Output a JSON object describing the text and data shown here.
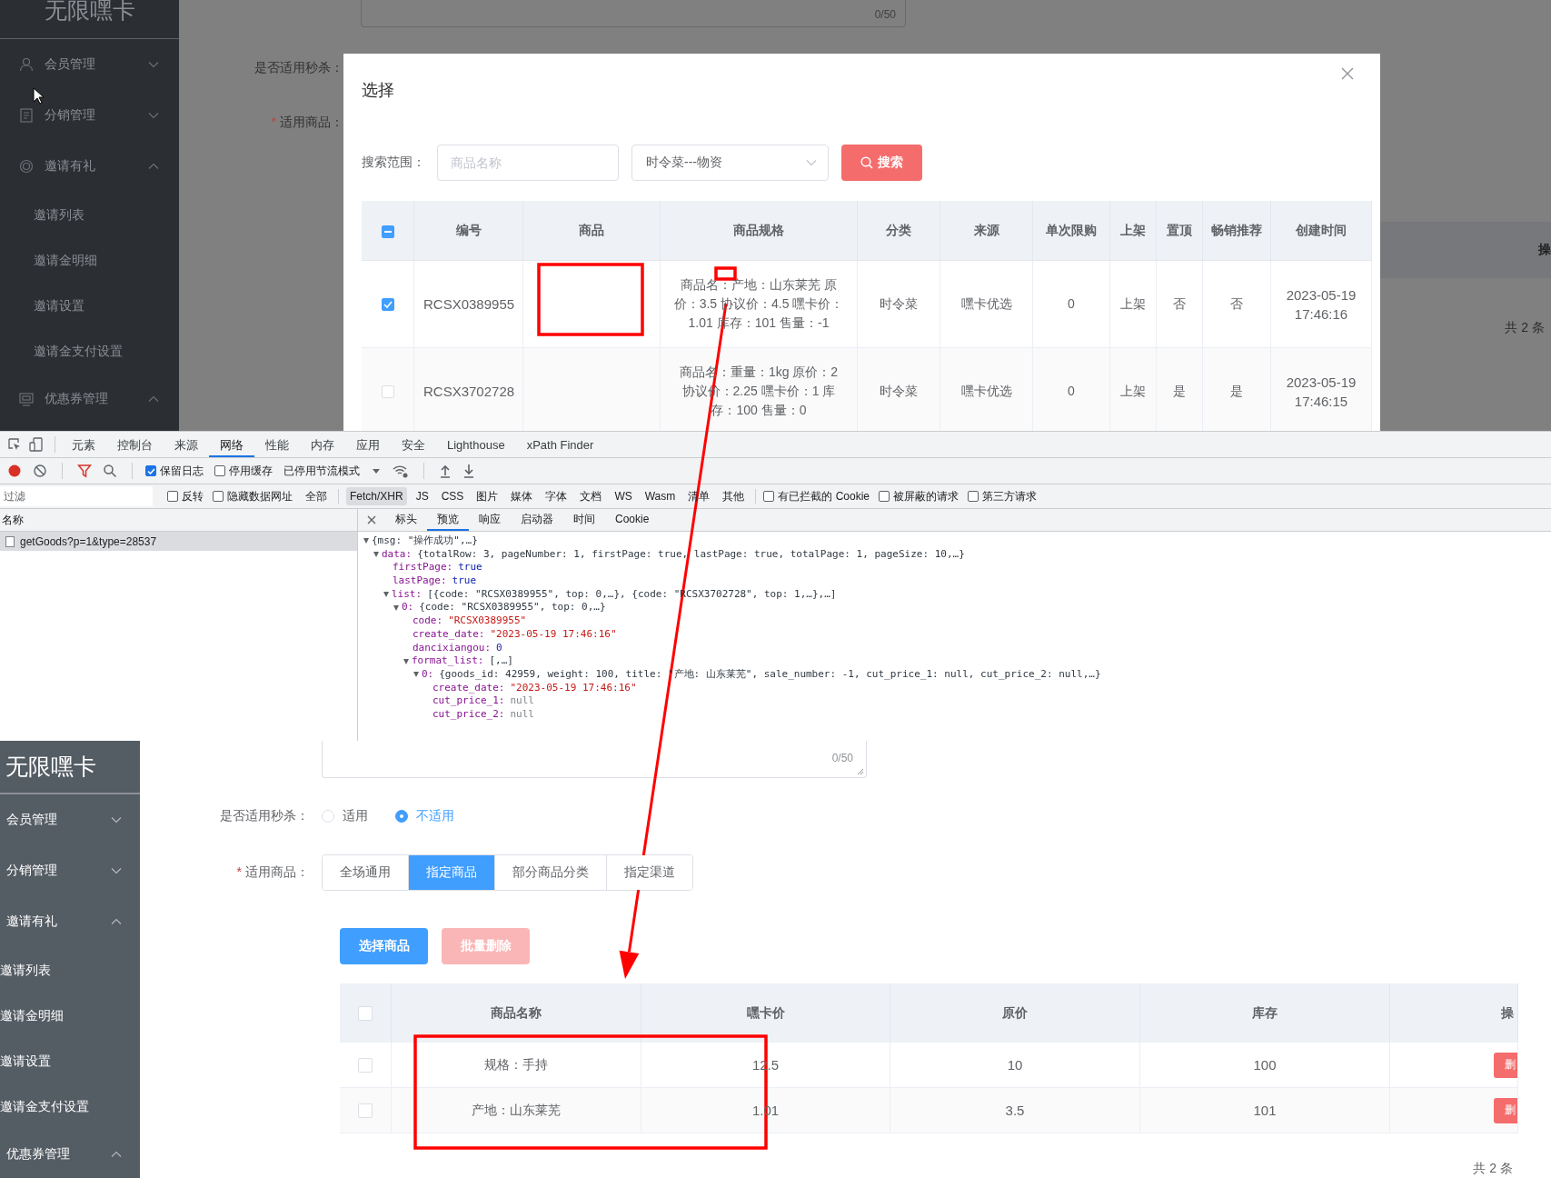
{
  "top_panel": {
    "sidebar": {
      "logo": "无限嘿卡",
      "items": [
        {
          "label": "会员管理",
          "expanded": false
        },
        {
          "label": "分销管理",
          "expanded": false
        },
        {
          "label": "邀请有礼",
          "expanded": true,
          "children": [
            {
              "label": "邀请列表"
            },
            {
              "label": "邀请金明细"
            },
            {
              "label": "邀请设置"
            },
            {
              "label": "邀请金支付设置"
            }
          ]
        },
        {
          "label": "优惠券管理",
          "expanded": true
        }
      ]
    },
    "background": {
      "counter": "0/50",
      "seckill_label": "是否适用秒杀：",
      "goods_label": "适用商品：",
      "required_mark": "*",
      "column_header": "操",
      "total": "共 2 条"
    },
    "dialog": {
      "title": "选择",
      "search_label": "搜索范围：",
      "name_field": {
        "placeholder": "商品名称"
      },
      "category_select": {
        "value": "时令菜---物资"
      },
      "search_button": "搜索",
      "table": {
        "header_indeterminate": true,
        "columns": [
          "编号",
          "商品",
          "商品规格",
          "分类",
          "来源",
          "单次限购",
          "上架",
          "置顶",
          "畅销推荐",
          "创建时间"
        ],
        "rows": [
          {
            "checked": true,
            "cells": [
              "RCSX0389955",
              "",
              "商品名：产地：山东莱芜 原价：3.5 协议价：4.5 嘿卡价：1.01 库存：101 售量：-1",
              "时令菜",
              "嘿卡优选",
              "0",
              "上架",
              "否",
              "否",
              "2023-05-19 17:46:16"
            ]
          },
          {
            "checked": false,
            "cells": [
              "RCSX3702728",
              "",
              "商品名：重量：1kg 原价：2 协议价：2.25 嘿卡价：1 库存：100 售量：0",
              "时令菜",
              "嘿卡优选",
              "0",
              "上架",
              "是",
              "是",
              "2023-05-19 17:46:15"
            ]
          }
        ]
      }
    }
  },
  "devtools": {
    "tabs": [
      {
        "label": "元素",
        "selected": false
      },
      {
        "label": "控制台",
        "selected": false
      },
      {
        "label": "来源",
        "selected": false
      },
      {
        "label": "网络",
        "selected": true
      },
      {
        "label": "性能",
        "selected": false
      },
      {
        "label": "内存",
        "selected": false
      },
      {
        "label": "应用",
        "selected": false
      },
      {
        "label": "安全",
        "selected": false
      },
      {
        "label": "Lighthouse",
        "selected": false
      },
      {
        "label": "xPath Finder",
        "selected": false
      }
    ],
    "toolbar": {
      "options": [
        {
          "label": "保留日志",
          "checked": true
        },
        {
          "label": "停用缓存",
          "checked": false
        }
      ],
      "throttle": "已停用节流模式"
    },
    "filter": {
      "placeholder": "过滤",
      "options": [
        {
          "label": "反转",
          "checked": false
        },
        {
          "label": "隐藏数据网址",
          "checked": false
        }
      ],
      "types": [
        {
          "label": "全部",
          "selected": false
        },
        {
          "label": "Fetch/XHR",
          "selected": true
        },
        {
          "label": "JS",
          "selected": false
        },
        {
          "label": "CSS",
          "selected": false
        },
        {
          "label": "图片",
          "selected": false
        },
        {
          "label": "媒体",
          "selected": false
        },
        {
          "label": "字体",
          "selected": false
        },
        {
          "label": "文档",
          "selected": false
        },
        {
          "label": "WS",
          "selected": false
        },
        {
          "label": "Wasm",
          "selected": false
        },
        {
          "label": "清单",
          "selected": false
        },
        {
          "label": "其他",
          "selected": false
        }
      ],
      "extra_options": [
        {
          "label": "有已拦截的 Cookie",
          "checked": false
        },
        {
          "label": "被屏蔽的请求",
          "checked": false
        },
        {
          "label": "第三方请求",
          "checked": false
        }
      ]
    },
    "requests": {
      "header": "名称",
      "items": [
        {
          "name": "getGoods?p=1&type=28537",
          "selected": true
        }
      ]
    },
    "detail": {
      "tabs": [
        {
          "label": "标头",
          "selected": false
        },
        {
          "label": "预览",
          "selected": true
        },
        {
          "label": "响应",
          "selected": false
        },
        {
          "label": "启动器",
          "selected": false
        },
        {
          "label": "时间",
          "selected": false
        },
        {
          "label": "Cookie",
          "selected": false
        }
      ],
      "tree": [
        {
          "value": "{msg: \"操作成功\",…}",
          "kind": "summary",
          "expanded": true,
          "children": [
            {
              "key": "data:",
              "value": "{totalRow: 3, pageNumber: 1, firstPage: true, lastPage: true, totalPage: 1, pageSize: 10,…}",
              "kind": "summary",
              "expanded": true,
              "children": [
                {
                  "key": "firstPage:",
                  "value": "true",
                  "kind": "boolean"
                },
                {
                  "key": "lastPage:",
                  "value": "true",
                  "kind": "boolean"
                },
                {
                  "key": "list:",
                  "value": "[{code: \"RCSX0389955\", top: 0,…}, {code: \"RCSX3702728\", top: 1,…},…]",
                  "kind": "summary",
                  "expanded": true,
                  "children": [
                    {
                      "key": "0:",
                      "value": "{code: \"RCSX0389955\", top: 0,…}",
                      "kind": "summary",
                      "expanded": true,
                      "children": [
                        {
                          "key": "code:",
                          "value": "\"RCSX0389955\"",
                          "kind": "string"
                        },
                        {
                          "key": "create_date:",
                          "value": "\"2023-05-19 17:46:16\"",
                          "kind": "string"
                        },
                        {
                          "key": "dancixiangou:",
                          "value": "0",
                          "kind": "number"
                        },
                        {
                          "key": "format_list:",
                          "value": "[,…]",
                          "kind": "summary",
                          "expanded": true,
                          "children": [
                            {
                              "key": "0:",
                              "value": "{goods_id: 42959, weight: 100, title: \"产地: 山东莱芜\", sale_number: -1, cut_price_1: null, cut_price_2: null,…}",
                              "kind": "summary",
                              "expanded": true,
                              "children": [
                                {
                                  "key": "create_date:",
                                  "value": "\"2023-05-19 17:46:16\"",
                                  "kind": "string"
                                },
                                {
                                  "key": "cut_price_1:",
                                  "value": "null",
                                  "kind": "null"
                                },
                                {
                                  "key": "cut_price_2:",
                                  "value": "null",
                                  "kind": "null"
                                }
                              ]
                            }
                          ]
                        }
                      ]
                    }
                  ]
                }
              ]
            }
          ]
        }
      ]
    }
  },
  "bottom_panel": {
    "sidebar": {
      "logo": "无限嘿卡",
      "items": [
        {
          "label": "会员管理",
          "expanded": false
        },
        {
          "label": "分销管理",
          "expanded": false
        },
        {
          "label": "邀请有礼",
          "expanded": true,
          "children": [
            {
              "label": "邀请列表"
            },
            {
              "label": "邀请金明细"
            },
            {
              "label": "邀请设置"
            },
            {
              "label": "邀请金支付设置"
            }
          ]
        },
        {
          "label": "优惠券管理",
          "expanded": true
        }
      ]
    },
    "form": {
      "counter": "0/50",
      "seckill": {
        "label": "是否适用秒杀：",
        "options": [
          {
            "label": "适用",
            "selected": false
          },
          {
            "label": "不适用",
            "selected": true
          }
        ]
      },
      "goods": {
        "label": "适用商品：",
        "required_mark": "*",
        "options": [
          {
            "label": "全场通用",
            "selected": false
          },
          {
            "label": "指定商品",
            "selected": true
          },
          {
            "label": "部分商品分类",
            "selected": false
          },
          {
            "label": "指定渠道",
            "selected": false
          }
        ]
      },
      "buttons": [
        {
          "label": "选择商品",
          "disabled": false
        },
        {
          "label": "批量删除",
          "disabled": true
        }
      ],
      "table": {
        "header_checked": false,
        "columns": [
          "商品名称",
          "嘿卡价",
          "原价",
          "库存",
          "操"
        ],
        "rows": [
          {
            "checked": false,
            "cells": [
              "规格：手持",
              "12.5",
              "10",
              "100"
            ],
            "action": "删"
          },
          {
            "checked": false,
            "cells": [
              "产地：山东莱芜",
              "1.01",
              "3.5",
              "101"
            ],
            "action": "删"
          }
        ]
      },
      "total": "共 2 条"
    }
  },
  "annotations": [
    {
      "kind": "box"
    },
    {
      "kind": "box"
    },
    {
      "kind": "box"
    },
    {
      "kind": "arrow"
    }
  ]
}
